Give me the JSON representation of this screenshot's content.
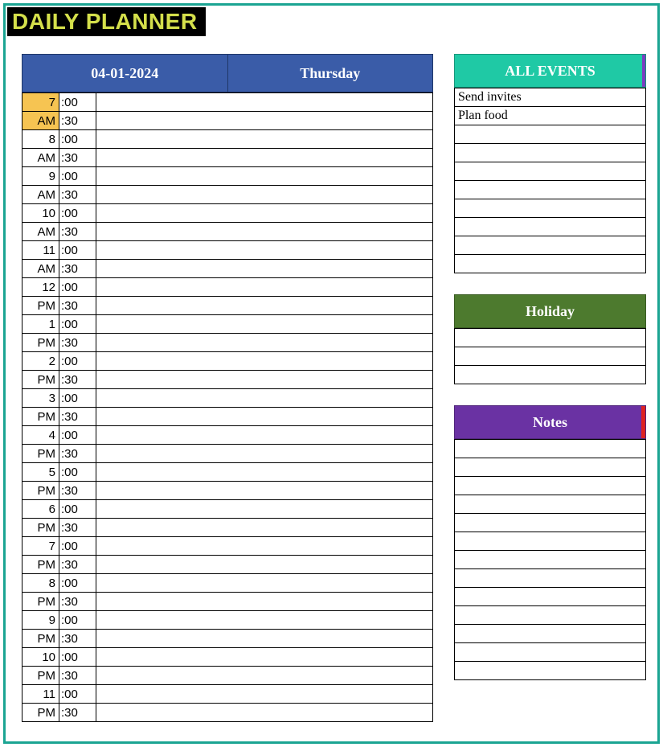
{
  "title": "DAILY PLANNER",
  "date": "04-01-2024",
  "day": "Thursday",
  "schedule": [
    {
      "hour": "7",
      "ampm": "AM",
      "highlight": true
    },
    {
      "hour": "8",
      "ampm": "AM",
      "highlight": false
    },
    {
      "hour": "9",
      "ampm": "AM",
      "highlight": false
    },
    {
      "hour": "10",
      "ampm": "AM",
      "highlight": false
    },
    {
      "hour": "11",
      "ampm": "AM",
      "highlight": false
    },
    {
      "hour": "12",
      "ampm": "PM",
      "highlight": false
    },
    {
      "hour": "1",
      "ampm": "PM",
      "highlight": false
    },
    {
      "hour": "2",
      "ampm": "PM",
      "highlight": false
    },
    {
      "hour": "3",
      "ampm": "PM",
      "highlight": false
    },
    {
      "hour": "4",
      "ampm": "PM",
      "highlight": false
    },
    {
      "hour": "5",
      "ampm": "PM",
      "highlight": false
    },
    {
      "hour": "6",
      "ampm": "PM",
      "highlight": false
    },
    {
      "hour": "7",
      "ampm": "PM",
      "highlight": false
    },
    {
      "hour": "8",
      "ampm": "PM",
      "highlight": false
    },
    {
      "hour": "9",
      "ampm": "PM",
      "highlight": false
    },
    {
      "hour": "10",
      "ampm": "PM",
      "highlight": false
    },
    {
      "hour": "11",
      "ampm": "PM",
      "highlight": false
    }
  ],
  "minute_labels": {
    "top": ":00",
    "bottom": ":30"
  },
  "events": {
    "header": "ALL EVENTS",
    "rows": [
      "Send invites",
      "Plan food",
      "",
      "",
      "",
      "",
      "",
      "",
      "",
      ""
    ]
  },
  "holiday": {
    "header": "Holiday",
    "rows": [
      "",
      "",
      ""
    ]
  },
  "notes": {
    "header": "Notes",
    "rows": [
      "",
      "",
      "",
      "",
      "",
      "",
      "",
      "",
      "",
      "",
      "",
      "",
      ""
    ]
  }
}
